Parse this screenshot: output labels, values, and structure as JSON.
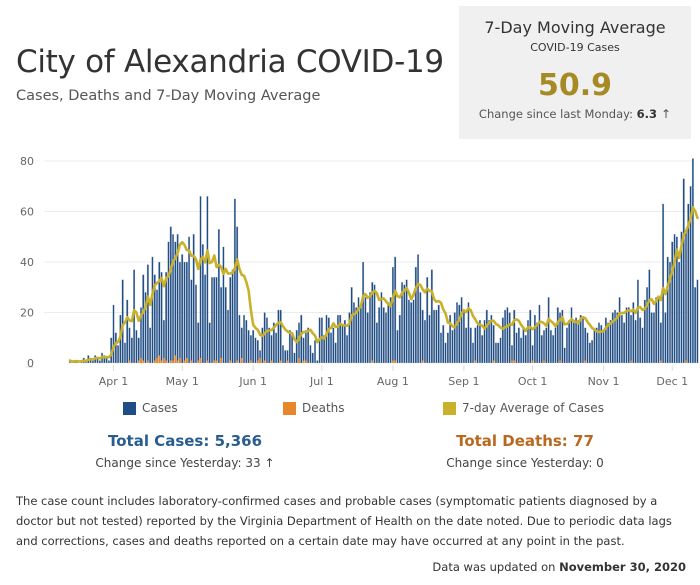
{
  "header": {
    "title": "City of Alexandria COVID-19",
    "subtitle": "Cases, Deaths  and 7-Day Moving Average"
  },
  "kpi": {
    "title": "7-Day Moving Average",
    "subtitle": "COVID-19 Cases",
    "value": "50.9",
    "change_label": "Change since last Monday: ",
    "change_value": "6.3",
    "change_icon": "arrow-up-icon",
    "change_arrow": "↑"
  },
  "legend": [
    {
      "label": "Cases",
      "color": "#1f4e87"
    },
    {
      "label": "Deaths",
      "color": "#e8862b"
    },
    {
      "label": "7-day Average of Cases",
      "color": "#c9b12b"
    }
  ],
  "totals": {
    "cases_label": "Total Cases: 5,366",
    "cases_change": "Change since Yesterday: 33",
    "cases_arrow": "↑",
    "deaths_label": "Total Deaths: 77",
    "deaths_change": "Change since Yesterday: 0"
  },
  "colors": {
    "cases": "#1f4e87",
    "deaths": "#e8862b",
    "average": "#c9b12b",
    "cases_total_text": "#2a5d8f",
    "deaths_total_text": "#b8691f",
    "kpi_value": "#a68b25"
  },
  "note": "The case count includes laboratory-confirmed cases and probable cases (symptomatic patients diagnosed by a doctor but not tested) reported by the Virginia Department of Health on the date noted. Due to periodic data lags and corrections, cases and deaths reported on a certain date may have occurred at any point in the past.",
  "updated": {
    "prefix": "Data was updated on ",
    "date": "November 30, 2020"
  },
  "chart_data": {
    "type": "bar",
    "title": "Cases, Deaths and 7-Day Moving Average",
    "xlabel": "",
    "ylabel": "",
    "ylim": [
      0,
      80
    ],
    "yticks": [
      0,
      20,
      40,
      60,
      80
    ],
    "grid": true,
    "legend_position": "bottom",
    "start_date": "2020-03-13",
    "end_date": "2020-11-30",
    "x_tick_labels": [
      "Apr 1",
      "May 1",
      "Jun 1",
      "Jul 1",
      "Aug 1",
      "Sep 1",
      "Oct 1",
      "Nov 1",
      "Dec 1"
    ],
    "x_tick_days_from_start": [
      19,
      49,
      80,
      110,
      141,
      172,
      202,
      233,
      263
    ],
    "series": [
      {
        "name": "Cases",
        "type": "bar",
        "values": [
          1,
          0,
          1,
          1,
          0,
          1,
          2,
          1,
          3,
          2,
          1,
          3,
          2,
          1,
          4,
          3,
          2,
          1,
          10,
          23,
          12,
          7,
          19,
          33,
          8,
          25,
          14,
          10,
          37,
          13,
          10,
          22,
          35,
          28,
          39,
          14,
          42,
          35,
          29,
          40,
          36,
          17,
          36,
          48,
          54,
          51,
          48,
          51,
          40,
          43,
          40,
          40,
          50,
          33,
          51,
          31,
          16,
          66,
          47,
          35,
          66,
          16,
          34,
          34,
          34,
          53,
          30,
          46,
          30,
          21,
          34,
          37,
          65,
          54,
          19,
          14,
          19,
          17,
          13,
          11,
          13,
          10,
          9,
          5,
          14,
          20,
          18,
          14,
          11,
          16,
          12,
          21,
          21,
          7,
          5,
          5,
          13,
          11,
          4,
          13,
          16,
          19,
          10,
          13,
          14,
          7,
          4,
          9,
          1,
          18,
          18,
          11,
          19,
          18,
          12,
          14,
          8,
          19,
          19,
          15,
          17,
          11,
          20,
          30,
          24,
          22,
          26,
          23,
          40,
          26,
          20,
          28,
          32,
          31,
          16,
          22,
          28,
          22,
          20,
          24,
          26,
          38,
          42,
          13,
          19,
          32,
          31,
          33,
          25,
          24,
          25,
          38,
          43,
          28,
          21,
          17,
          34,
          19,
          37,
          21,
          21,
          23,
          12,
          15,
          8,
          12,
          19,
          13,
          20,
          24,
          23,
          26,
          21,
          14,
          24,
          14,
          8,
          14,
          15,
          17,
          11,
          17,
          21,
          17,
          19,
          15,
          8,
          8,
          10,
          18,
          21,
          22,
          20,
          7,
          21,
          12,
          14,
          10,
          14,
          11,
          17,
          21,
          7,
          19,
          16,
          23,
          11,
          13,
          14,
          26,
          13,
          11,
          14,
          22,
          20,
          21,
          6,
          14,
          17,
          22,
          16,
          18,
          17,
          19,
          18,
          14,
          12,
          8,
          9,
          13,
          14,
          16,
          15,
          13,
          18,
          16,
          17,
          20,
          21,
          20,
          26,
          19,
          16,
          22,
          22,
          19,
          24,
          17,
          33,
          18,
          14,
          25,
          30,
          37,
          20,
          20,
          26,
          26,
          16,
          63,
          20,
          42,
          40,
          48,
          51,
          50,
          40,
          52,
          73,
          52,
          63,
          70,
          81,
          30,
          33
        ]
      },
      {
        "name": "Deaths",
        "type": "bar",
        "values": [
          0,
          0,
          0,
          0,
          0,
          0,
          0,
          0,
          0,
          0,
          0,
          0,
          0,
          0,
          0,
          0,
          0,
          0,
          0,
          0,
          0,
          0,
          0,
          0,
          0,
          0,
          1,
          0,
          0,
          0,
          1,
          2,
          1,
          0,
          1,
          0,
          0,
          1,
          2,
          3,
          1,
          2,
          1,
          0,
          1,
          1,
          3,
          1,
          2,
          0,
          1,
          2,
          0,
          1,
          0,
          0,
          1,
          2,
          0,
          0,
          1,
          0,
          0,
          1,
          1,
          0,
          2,
          0,
          0,
          0,
          1,
          0,
          0,
          1,
          0,
          2,
          0,
          0,
          0,
          1,
          0,
          0,
          1,
          2,
          0,
          1,
          0,
          0,
          1,
          0,
          0,
          0,
          1,
          0,
          0,
          1,
          0,
          0,
          0,
          0,
          2,
          0,
          1,
          1,
          0,
          0,
          0,
          0,
          0,
          0,
          0,
          0,
          0,
          0,
          0,
          0,
          0,
          0,
          0,
          0,
          0,
          0,
          0,
          0,
          0,
          0,
          0,
          0,
          0,
          0,
          0,
          0,
          1,
          0,
          0,
          0,
          0,
          0,
          0,
          0,
          0,
          1,
          1,
          0,
          0,
          0,
          0,
          0,
          0,
          0,
          0,
          0,
          0,
          0,
          1,
          0,
          0,
          0,
          0,
          0,
          0,
          0,
          0,
          0,
          0,
          0,
          0,
          0,
          0,
          0,
          0,
          0,
          0,
          0,
          0,
          0,
          0,
          1,
          0,
          0,
          0,
          0,
          0,
          0,
          0,
          1,
          0,
          0,
          0,
          0,
          0,
          0,
          0,
          1,
          1,
          0,
          0,
          0,
          0,
          0,
          0,
          0,
          1,
          0,
          0,
          0,
          0,
          1,
          0,
          0,
          0,
          0,
          0,
          0,
          1,
          0,
          0,
          0,
          0,
          0,
          0,
          0,
          0,
          0,
          0,
          1,
          0,
          0,
          0,
          0,
          0,
          0,
          0,
          0,
          0,
          0,
          0,
          0,
          0,
          0,
          0,
          0,
          0,
          0,
          0,
          1,
          0,
          0,
          0,
          0,
          0,
          0,
          0,
          0,
          0,
          0,
          0,
          0,
          1,
          0,
          0,
          0,
          0,
          0,
          0,
          0,
          0,
          0,
          0,
          1,
          0,
          0
        ]
      },
      {
        "name": "7-day Average of Cases",
        "type": "line",
        "note": "computed from Cases as trailing 7-day mean; last value 50.9"
      }
    ]
  }
}
